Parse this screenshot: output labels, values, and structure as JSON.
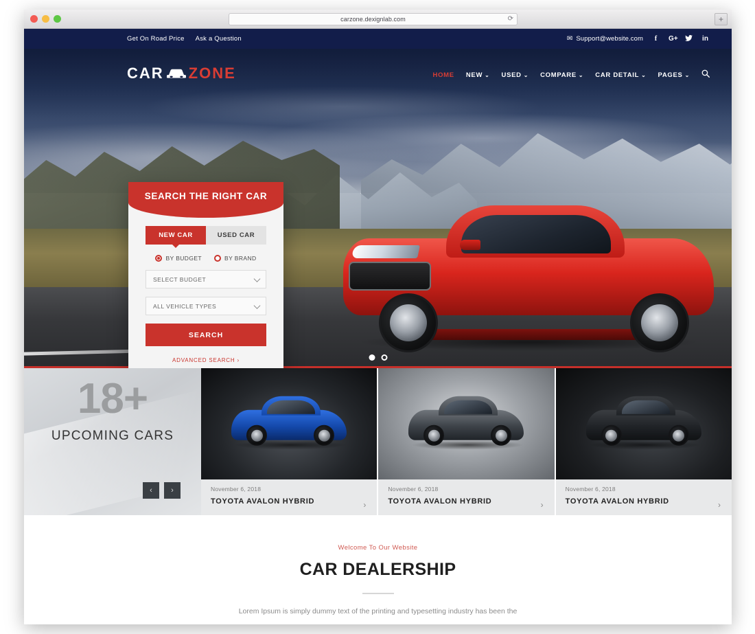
{
  "browser": {
    "url": "carzone.dexignlab.com",
    "reload_icon": "reload-icon",
    "newtab_label": "+"
  },
  "topbar": {
    "links": [
      {
        "label": "Get On Road Price"
      },
      {
        "label": "Ask a Question"
      }
    ],
    "email": "Support@website.com",
    "mail_icon": "✉",
    "social": [
      {
        "name": "facebook",
        "glyph": "f"
      },
      {
        "name": "google-plus",
        "glyph": "G+"
      },
      {
        "name": "twitter",
        "glyph": "🐦"
      },
      {
        "name": "linkedin",
        "glyph": "in"
      }
    ]
  },
  "header": {
    "logo": {
      "part1": "CAR",
      "part2": "ZONE",
      "icon": "car-icon"
    },
    "nav": [
      {
        "label": "HOME",
        "active": true,
        "caret": ""
      },
      {
        "label": "NEW",
        "active": false,
        "caret": "⌄"
      },
      {
        "label": "USED",
        "active": false,
        "caret": "⌄"
      },
      {
        "label": "COMPARE",
        "active": false,
        "caret": "⌄"
      },
      {
        "label": "CAR DETAIL",
        "active": false,
        "caret": "⌄"
      },
      {
        "label": "PAGES",
        "active": false,
        "caret": "⌄"
      }
    ],
    "search_icon": "🔍"
  },
  "search_panel": {
    "title": "SEARCH THE RIGHT CAR",
    "tabs": [
      {
        "label": "NEW CAR",
        "active": true
      },
      {
        "label": "USED CAR",
        "active": false
      }
    ],
    "radios": [
      {
        "label": "BY BUDGET",
        "selected": true
      },
      {
        "label": "BY BRAND",
        "selected": false
      }
    ],
    "selects": [
      {
        "value": "SELECT BUDGET"
      },
      {
        "value": "ALL VEHICLE TYPES"
      }
    ],
    "search_button": "SEARCH",
    "advanced_link": "ADVANCED SEARCH ›"
  },
  "hero": {
    "dots": [
      {
        "active": true
      },
      {
        "active": false
      }
    ]
  },
  "upcoming": {
    "count": "18+",
    "label": "UPCOMING CARS",
    "prev_label": "‹",
    "next_label": "›",
    "cards": [
      {
        "date": "November 6, 2018",
        "title": "TOYOTA AVALON HYBRID",
        "chevron": "›"
      },
      {
        "date": "November 6, 2018",
        "title": "TOYOTA AVALON HYBRID",
        "chevron": "›"
      },
      {
        "date": "November 6, 2018",
        "title": "TOYOTA AVALON HYBRID",
        "chevron": "›"
      }
    ]
  },
  "welcome": {
    "eyebrow": "Welcome To Our Website",
    "title": "CAR DEALERSHIP",
    "paragraph": "Lorem Ipsum is simply dummy text of the printing and typesetting industry has been the"
  },
  "colors": {
    "accent_red": "#c9332c",
    "navy": "#121d4a",
    "text_dark": "#1f1f1f"
  }
}
